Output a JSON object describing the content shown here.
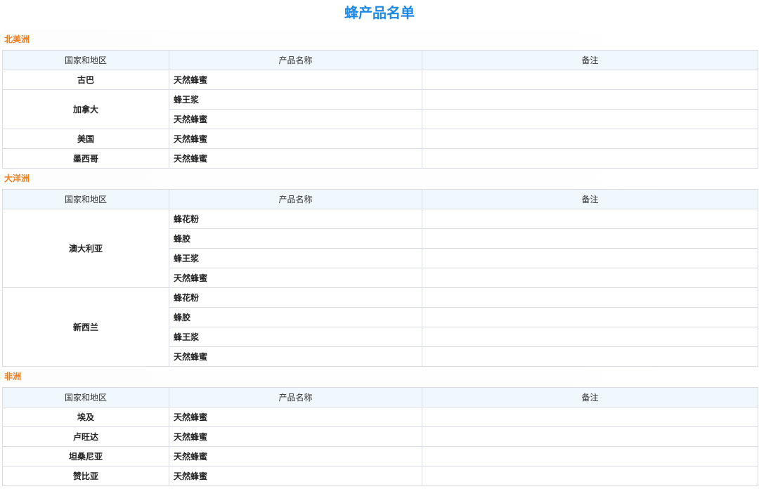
{
  "page": {
    "title": "蜂产品名单"
  },
  "headers": {
    "country": "国家和地区",
    "product": "产品名称",
    "remark": "备注"
  },
  "regions": [
    {
      "name": "北美洲",
      "countries": [
        {
          "name": "古巴",
          "products": [
            "天然蜂蜜"
          ]
        },
        {
          "name": "加拿大",
          "products": [
            "蜂王浆",
            "天然蜂蜜"
          ]
        },
        {
          "name": "美国",
          "products": [
            "天然蜂蜜"
          ]
        },
        {
          "name": "墨西哥",
          "products": [
            "天然蜂蜜"
          ]
        }
      ]
    },
    {
      "name": "大洋洲",
      "countries": [
        {
          "name": "澳大利亚",
          "products": [
            "蜂花粉",
            "蜂胶",
            "蜂王浆",
            "天然蜂蜜"
          ]
        },
        {
          "name": "新西兰",
          "products": [
            "蜂花粉",
            "蜂胶",
            "蜂王浆",
            "天然蜂蜜"
          ]
        }
      ]
    },
    {
      "name": "非洲",
      "countries": [
        {
          "name": "埃及",
          "products": [
            "天然蜂蜜"
          ]
        },
        {
          "name": "卢旺达",
          "products": [
            "天然蜂蜜"
          ]
        },
        {
          "name": "坦桑尼亚",
          "products": [
            "天然蜂蜜"
          ]
        },
        {
          "name": "赞比亚",
          "products": [
            "天然蜂蜜"
          ]
        }
      ]
    }
  ],
  "colors": {
    "title": "#1e88e5",
    "region": "#f07c1c",
    "header_bg": "#f0f7fd",
    "border": "#d9dde3"
  }
}
